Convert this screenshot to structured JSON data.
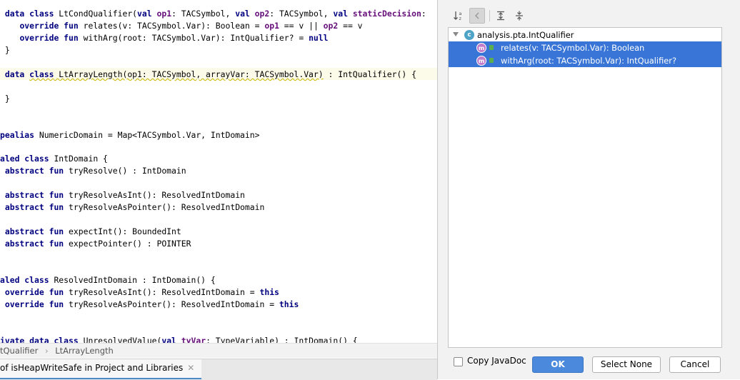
{
  "editor": {
    "lines": [
      [
        {
          "t": " "
        },
        {
          "t": "data",
          "c": "kw"
        },
        {
          "t": " "
        },
        {
          "t": "class",
          "c": "kw"
        },
        {
          "t": " LtCondQualifier("
        },
        {
          "t": "val",
          "c": "kw"
        },
        {
          "t": " "
        },
        {
          "t": "op1",
          "c": "field"
        },
        {
          "t": ": TACSymbol, "
        },
        {
          "t": "val",
          "c": "kw"
        },
        {
          "t": " "
        },
        {
          "t": "op2",
          "c": "field"
        },
        {
          "t": ": TACSymbol, "
        },
        {
          "t": "val",
          "c": "kw"
        },
        {
          "t": " "
        },
        {
          "t": "staticDecision",
          "c": "field"
        },
        {
          "t": ":"
        }
      ],
      [
        {
          "t": "    "
        },
        {
          "t": "override",
          "c": "kw"
        },
        {
          "t": " "
        },
        {
          "t": "fun",
          "c": "kw"
        },
        {
          "t": " relates(v: TACSymbol.Var): Boolean = "
        },
        {
          "t": "op1",
          "c": "field"
        },
        {
          "t": " == v || "
        },
        {
          "t": "op2",
          "c": "field"
        },
        {
          "t": " == v"
        }
      ],
      [
        {
          "t": "    "
        },
        {
          "t": "override",
          "c": "kw"
        },
        {
          "t": " "
        },
        {
          "t": "fun",
          "c": "kw"
        },
        {
          "t": " withArg(root: TACSymbol.Var): IntQualifier? = "
        },
        {
          "t": "null",
          "c": "kw"
        }
      ],
      [
        {
          "t": " }"
        }
      ],
      [],
      [
        {
          "t": " "
        },
        {
          "t": "data",
          "c": "kw"
        },
        {
          "t": " "
        },
        {
          "t": "class",
          "c": "kw warn"
        },
        {
          "t": " LtArrayLength(op1: TACSymbol, arrayVar: TACSymbol.Var)",
          "c": "warn"
        },
        {
          "t": " : IntQualifier() {"
        }
      ],
      [],
      [
        {
          "t": " }"
        }
      ],
      [],
      [],
      [
        {
          "t": "pealias",
          "c": "kw"
        },
        {
          "t": " NumericDomain = Map<TACSymbol.Var, IntDomain>"
        }
      ],
      [],
      [
        {
          "t": "aled",
          "c": "kw"
        },
        {
          "t": " "
        },
        {
          "t": "class",
          "c": "kw"
        },
        {
          "t": " IntDomain {"
        }
      ],
      [
        {
          "t": " "
        },
        {
          "t": "abstract",
          "c": "kw"
        },
        {
          "t": " "
        },
        {
          "t": "fun",
          "c": "kw"
        },
        {
          "t": " tryResolve() : IntDomain"
        }
      ],
      [],
      [
        {
          "t": " "
        },
        {
          "t": "abstract",
          "c": "kw"
        },
        {
          "t": " "
        },
        {
          "t": "fun",
          "c": "kw"
        },
        {
          "t": " tryResolveAsInt(): ResolvedIntDomain"
        }
      ],
      [
        {
          "t": " "
        },
        {
          "t": "abstract",
          "c": "kw"
        },
        {
          "t": " "
        },
        {
          "t": "fun",
          "c": "kw"
        },
        {
          "t": " tryResolveAsPointer(): ResolvedIntDomain"
        }
      ],
      [],
      [
        {
          "t": " "
        },
        {
          "t": "abstract",
          "c": "kw"
        },
        {
          "t": " "
        },
        {
          "t": "fun",
          "c": "kw"
        },
        {
          "t": " expectInt(): BoundedInt"
        }
      ],
      [
        {
          "t": " "
        },
        {
          "t": "abstract",
          "c": "kw"
        },
        {
          "t": " "
        },
        {
          "t": "fun",
          "c": "kw"
        },
        {
          "t": " expectPointer() : POINTER"
        }
      ],
      [],
      [],
      [
        {
          "t": "aled",
          "c": "kw"
        },
        {
          "t": " "
        },
        {
          "t": "class",
          "c": "kw"
        },
        {
          "t": " ResolvedIntDomain : IntDomain() {"
        }
      ],
      [
        {
          "t": " "
        },
        {
          "t": "override",
          "c": "kw"
        },
        {
          "t": " "
        },
        {
          "t": "fun",
          "c": "kw"
        },
        {
          "t": " tryResolveAsInt(): ResolvedIntDomain = "
        },
        {
          "t": "this",
          "c": "kw"
        }
      ],
      [
        {
          "t": " "
        },
        {
          "t": "override",
          "c": "kw"
        },
        {
          "t": " "
        },
        {
          "t": "fun",
          "c": "kw"
        },
        {
          "t": " tryResolveAsPointer(): ResolvedIntDomain = "
        },
        {
          "t": "this",
          "c": "kw"
        }
      ],
      [],
      [],
      [
        {
          "t": "ivate",
          "c": "kw"
        },
        {
          "t": " "
        },
        {
          "t": "data",
          "c": "kw"
        },
        {
          "t": " "
        },
        {
          "t": "class",
          "c": "kw"
        },
        {
          "t": " UnresolvedValue("
        },
        {
          "t": "val",
          "c": "kw"
        },
        {
          "t": " "
        },
        {
          "t": "tyVar",
          "c": "field"
        },
        {
          "t": ": TypeVariable) : IntDomain() {"
        }
      ]
    ]
  },
  "breadcrumb": {
    "first": "tQualifier",
    "separator": "›",
    "second": "LtArrayLength"
  },
  "bottom_tab": {
    "label": "of isHeapWriteSafe in Project and Libraries",
    "close": "✕"
  },
  "dialog": {
    "tree": {
      "root": "analysis.pta.IntQualifier",
      "class_icon_text": "c",
      "method_icon_text": "m",
      "members": [
        "relates(v: TACSymbol.Var): Boolean",
        "withArg(root: TACSymbol.Var): IntQualifier?"
      ]
    },
    "copy_javadoc_label": "Copy JavaDoc",
    "ok_label": "OK",
    "select_none_label": "Select None",
    "cancel_label": "Cancel",
    "colors": {
      "selection": "#3875d7",
      "primary_button": "#4a89dc"
    }
  }
}
